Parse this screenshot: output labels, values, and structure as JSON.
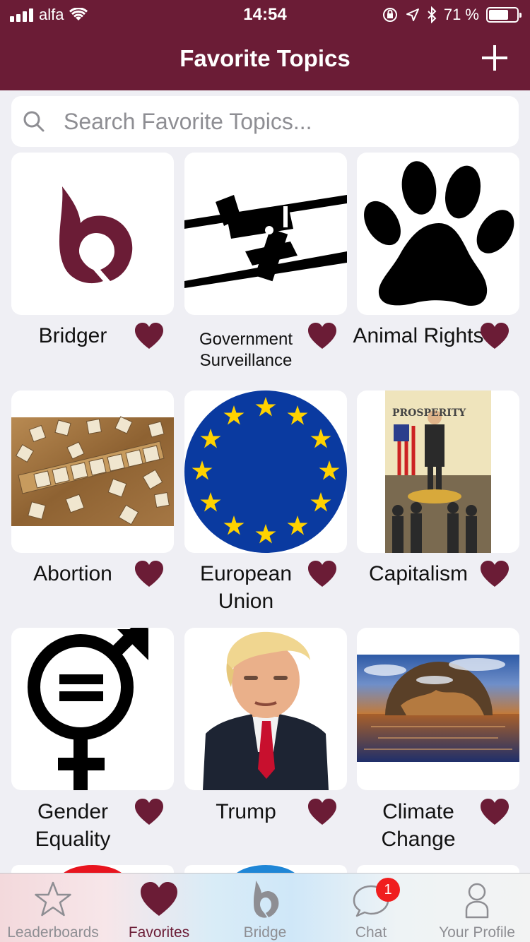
{
  "status_bar": {
    "carrier": "alfa",
    "time": "14:54",
    "battery": "71 %"
  },
  "header": {
    "title": "Favorite Topics"
  },
  "search": {
    "placeholder": "Search Favorite Topics..."
  },
  "colors": {
    "brand": "#6b1c36",
    "heart": "#6b1c36",
    "background": "#efeff4"
  },
  "topics": [
    {
      "label": "Bridger",
      "image": "bridger-logo"
    },
    {
      "label": "Government Surveillance",
      "image": "surveillance-camera"
    },
    {
      "label": "Animal Rights",
      "image": "paw-print"
    },
    {
      "label": "Abortion",
      "image": "scrabble-tiles-photo"
    },
    {
      "label": "European Union",
      "image": "eu-flag"
    },
    {
      "label": "Capitalism",
      "image": "prosperity-poster"
    },
    {
      "label": "Gender Equality",
      "image": "gender-equality-symbol"
    },
    {
      "label": "Trump",
      "image": "trump-portrait"
    },
    {
      "label": "Climate Change",
      "image": "sinking-earth"
    }
  ],
  "tabs": [
    {
      "label": "Leaderboards",
      "icon": "star-icon"
    },
    {
      "label": "Favorites",
      "icon": "heart-icon",
      "active": true
    },
    {
      "label": "Bridge",
      "icon": "bridger-icon"
    },
    {
      "label": "Chat",
      "icon": "chat-bubble-icon",
      "badge": "1"
    },
    {
      "label": "Your Profile",
      "icon": "person-icon"
    }
  ]
}
